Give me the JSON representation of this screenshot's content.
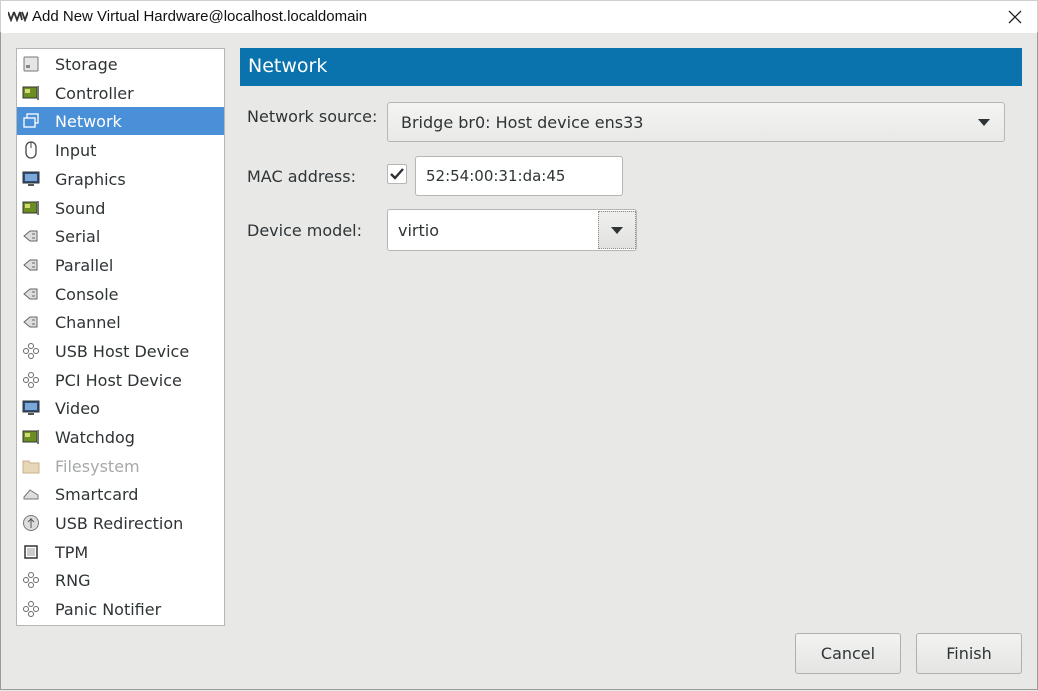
{
  "window": {
    "title": "Add New Virtual Hardware@localhost.localdomain"
  },
  "sidebar": {
    "items": [
      {
        "label": "Storage",
        "icon": "disk-icon",
        "state": "normal"
      },
      {
        "label": "Controller",
        "icon": "card-icon",
        "state": "normal"
      },
      {
        "label": "Network",
        "icon": "network-icon",
        "state": "selected"
      },
      {
        "label": "Input",
        "icon": "mouse-icon",
        "state": "normal"
      },
      {
        "label": "Graphics",
        "icon": "monitor-icon",
        "state": "normal"
      },
      {
        "label": "Sound",
        "icon": "card-icon",
        "state": "normal"
      },
      {
        "label": "Serial",
        "icon": "plug-icon",
        "state": "normal"
      },
      {
        "label": "Parallel",
        "icon": "plug-icon",
        "state": "normal"
      },
      {
        "label": "Console",
        "icon": "plug-icon",
        "state": "normal"
      },
      {
        "label": "Channel",
        "icon": "plug-icon",
        "state": "normal"
      },
      {
        "label": "USB Host Device",
        "icon": "usb-icon",
        "state": "normal"
      },
      {
        "label": "PCI Host Device",
        "icon": "usb-icon",
        "state": "normal"
      },
      {
        "label": "Video",
        "icon": "monitor-icon",
        "state": "normal"
      },
      {
        "label": "Watchdog",
        "icon": "card-icon",
        "state": "normal"
      },
      {
        "label": "Filesystem",
        "icon": "folder-icon",
        "state": "disabled"
      },
      {
        "label": "Smartcard",
        "icon": "smartcard-icon",
        "state": "normal"
      },
      {
        "label": "USB Redirection",
        "icon": "usb-redir-icon",
        "state": "normal"
      },
      {
        "label": "TPM",
        "icon": "chip-icon",
        "state": "normal"
      },
      {
        "label": "RNG",
        "icon": "usb-icon",
        "state": "normal"
      },
      {
        "label": "Panic Notifier",
        "icon": "usb-icon",
        "state": "normal"
      }
    ]
  },
  "main": {
    "header": "Network",
    "network_source_label": "Network source:",
    "network_source_value": "Bridge br0: Host device ens33",
    "mac_label": "MAC address:",
    "mac_checked": true,
    "mac_value": "52:54:00:31:da:45",
    "model_label": "Device model:",
    "model_value": "virtio"
  },
  "footer": {
    "cancel_label": "Cancel",
    "finish_label": "Finish"
  },
  "colors": {
    "header_bg": "#0a72ad",
    "selection_bg": "#4a90d9",
    "window_bg": "#e8e8e7"
  }
}
